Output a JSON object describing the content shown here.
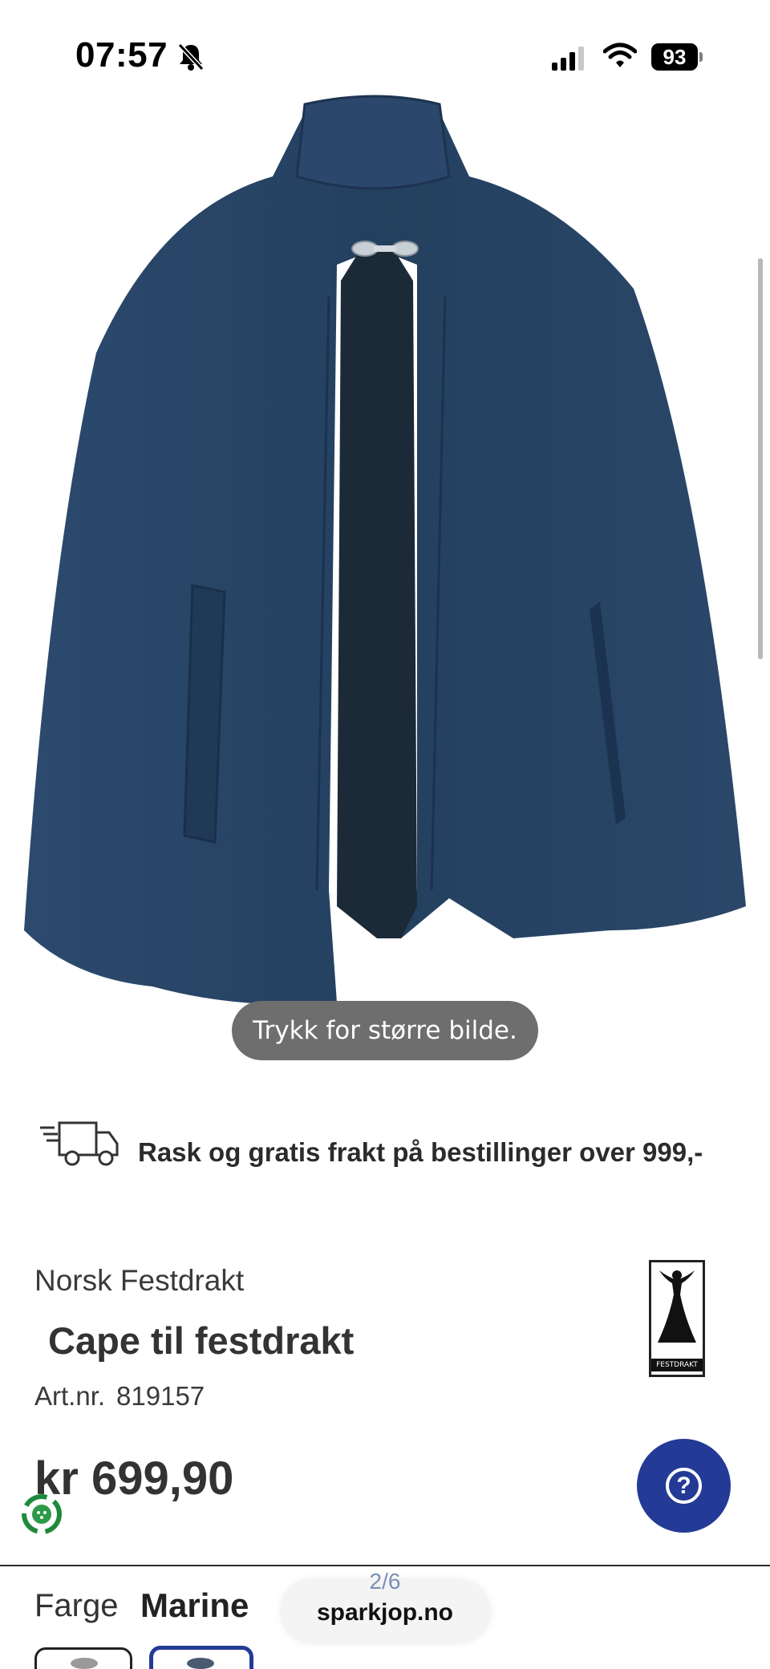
{
  "status_bar": {
    "time": "07:57",
    "battery_level": "93",
    "icons": [
      "bell-slash-icon",
      "cellular-signal-icon",
      "wifi-icon",
      "battery-icon"
    ]
  },
  "product_image": {
    "zoom_hint": "Trykk for større bilde.",
    "colors": {
      "fabric": "#243d5e",
      "lining": "#1c2a38"
    }
  },
  "shipping": {
    "icon": "delivery-truck-icon",
    "text": "Rask og gratis frakt på bestillinger over 999,-"
  },
  "product": {
    "brand": "Norsk Festdrakt",
    "title": "Cape til festdrakt",
    "article_label": "Art.nr.",
    "article_number": "819157",
    "price": "kr 699,90",
    "brand_logo_text": "FESTDRAKT"
  },
  "help_button": {
    "icon": "question-mark-icon",
    "color": "#233a96"
  },
  "color_selector": {
    "label": "Farge",
    "selected": "Marine"
  },
  "browser": {
    "page_counter": "2/6",
    "url": "sparkjop.no"
  }
}
